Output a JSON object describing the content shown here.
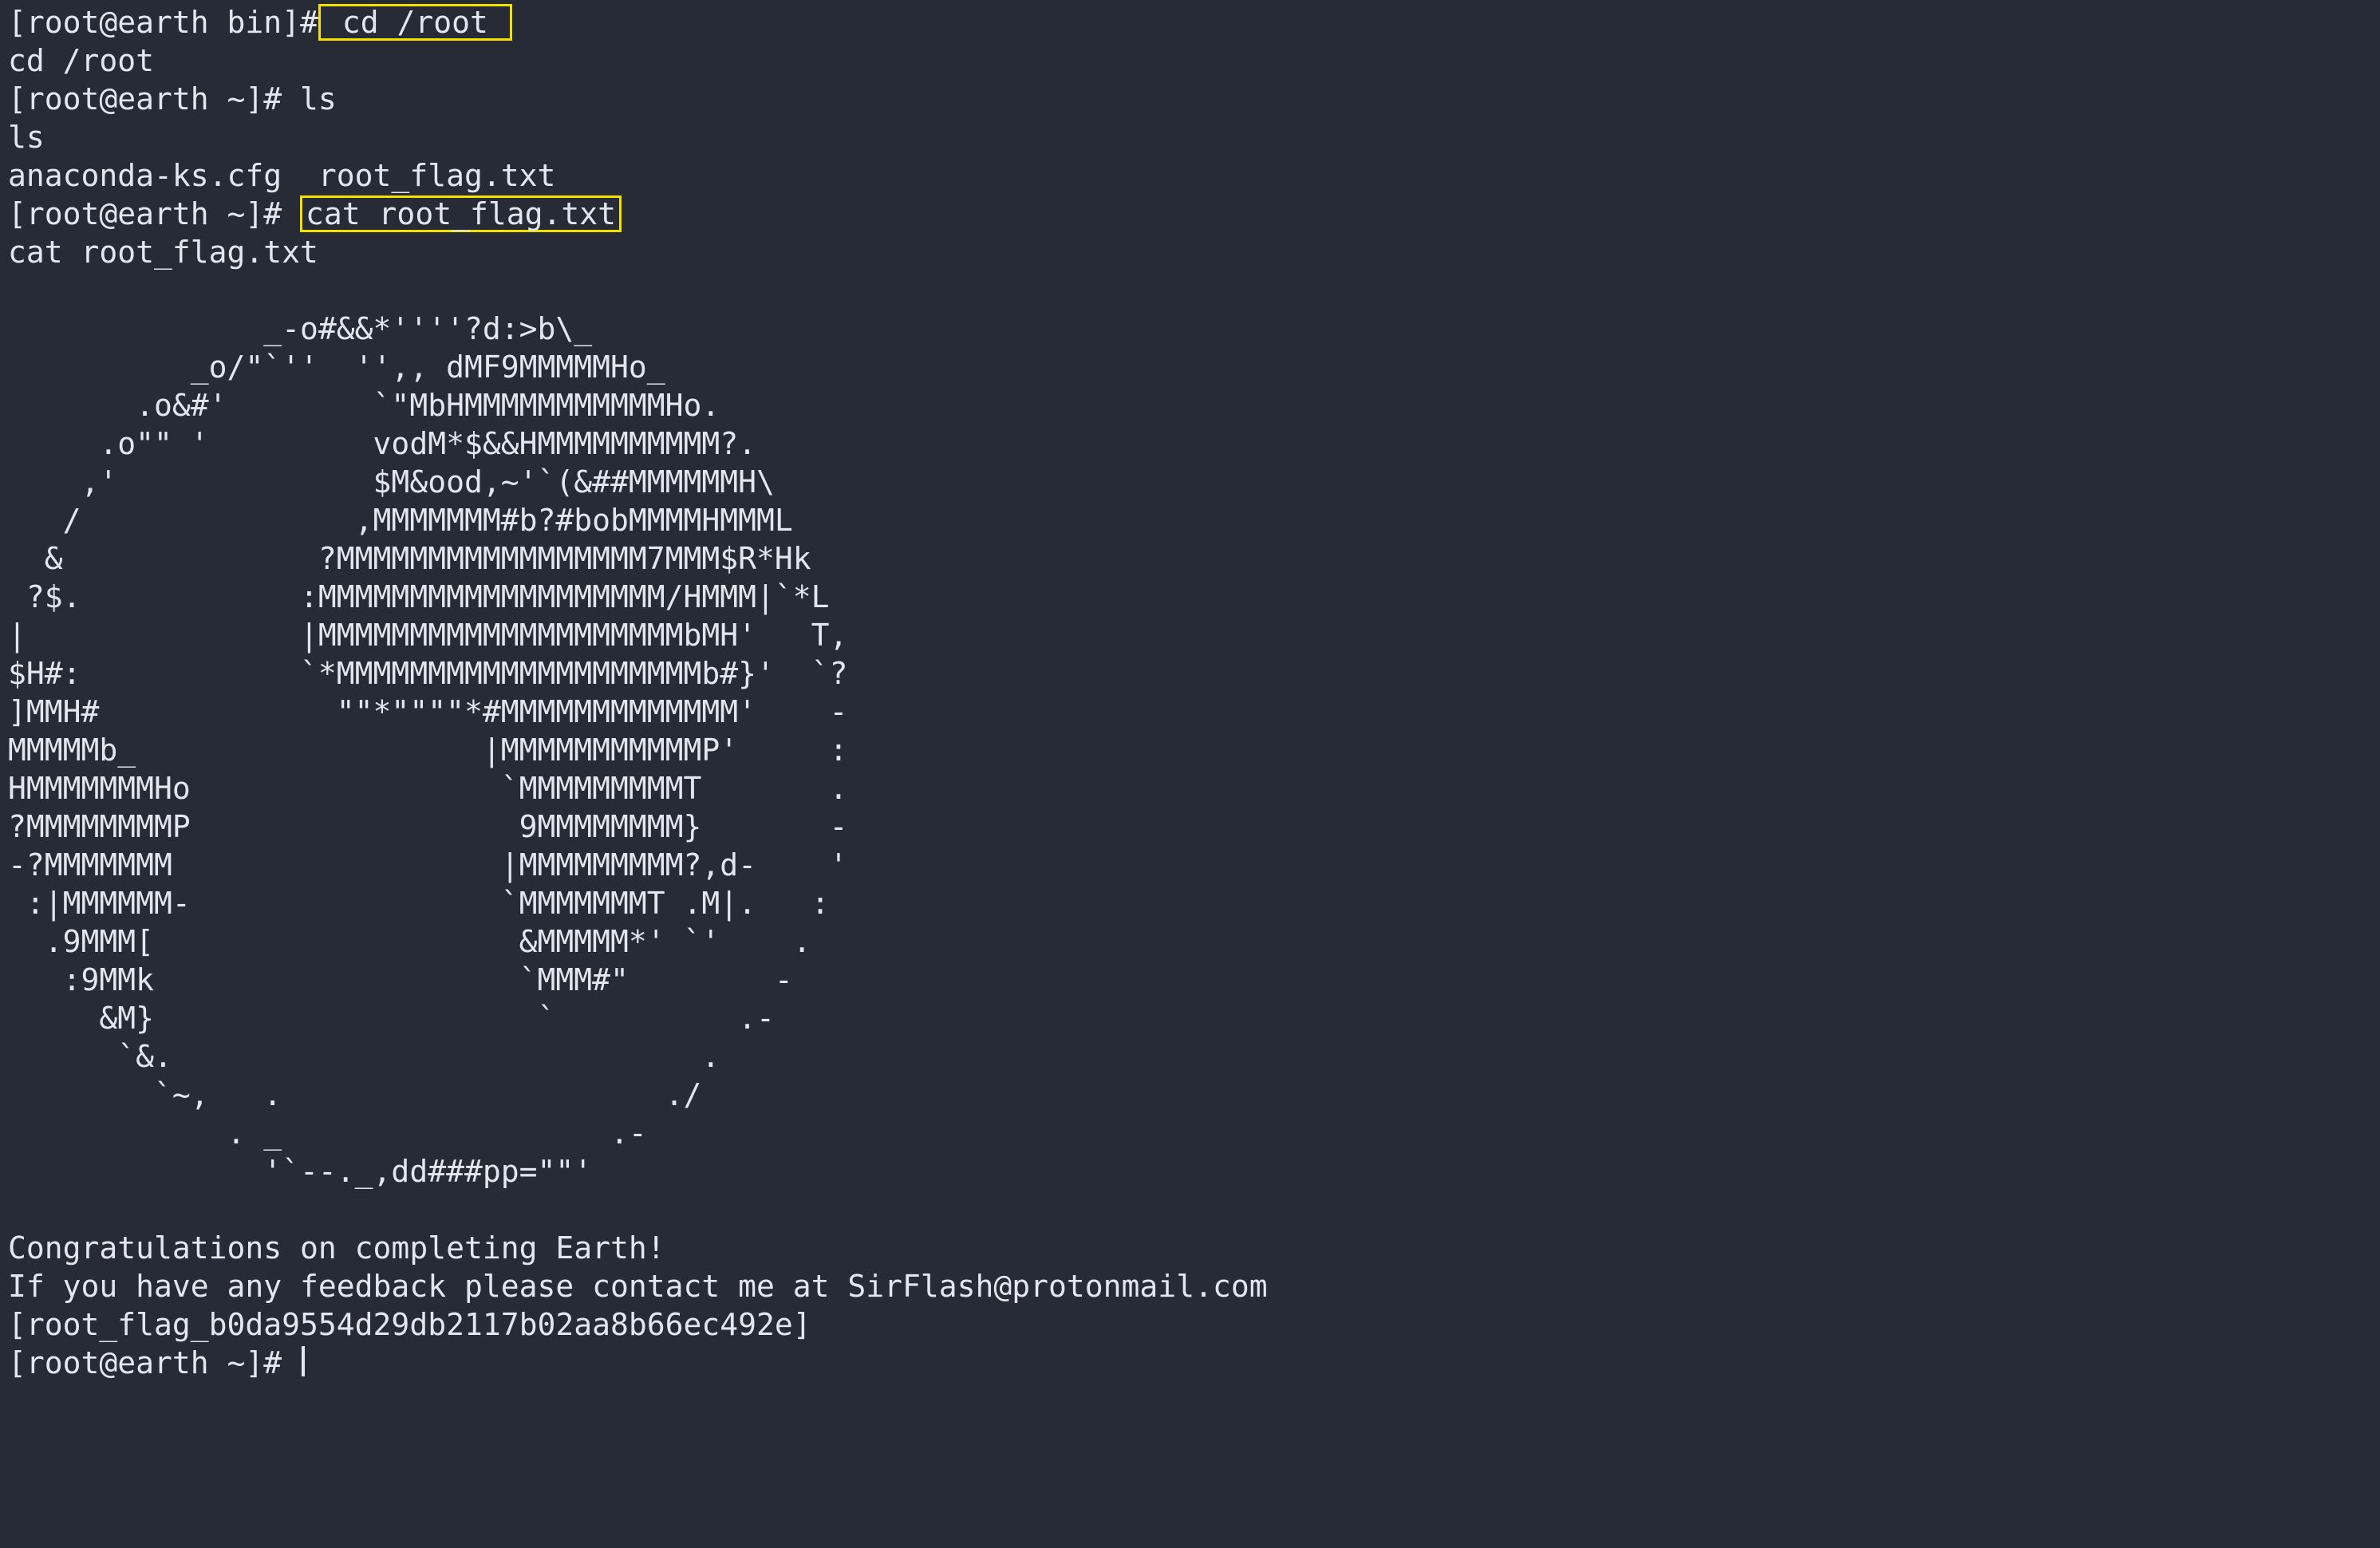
{
  "lines": {
    "l1_prompt": "[root@earth bin]#",
    "l1_cmd": " cd /root ",
    "l2": "cd /root",
    "l3": "[root@earth ~]# ls",
    "l4": "ls",
    "l5": "anaconda-ks.cfg  root_flag.txt",
    "l6_prompt": "[root@earth ~]# ",
    "l6_cmd": "cat root_flag.txt",
    "l7": "cat root_flag.txt",
    "a01": "              _-o#&&*''''?d:>b\\_",
    "a02": "          _o/\"`''  '',, dMF9MMMMMHo_",
    "a03": "       .o&#'        `\"MbHMMMMMMMMMMMHo.",
    "a04": "     .o\"\" '         vodM*$&&HMMMMMMMMMM?.",
    "a05": "    ,'              $M&ood,~'`(&##MMMMMMH\\",
    "a06": "   /               ,MMMMMMM#b?#bobMMMMHMMML",
    "a07": "  &              ?MMMMMMMMMMMMMMMMM7MMM$R*Hk",
    "a08": " ?$.            :MMMMMMMMMMMMMMMMMMM/HMMM|`*L",
    "a09": "|               |MMMMMMMMMMMMMMMMMMMMbMH'   T,",
    "a10": "$H#:            `*MMMMMMMMMMMMMMMMMMMMb#}'  `?",
    "a11": "]MMH#             \"\"*\"\"\"\"*#MMMMMMMMMMMMM'    -",
    "a12": "MMMMMb_                   |MMMMMMMMMMMP'     :",
    "a13": "HMMMMMMMHo                 `MMMMMMMMMT       .",
    "a14": "?MMMMMMMMP                  9MMMMMMMM}       -",
    "a15": "-?MMMMMMM                  |MMMMMMMMM?,d-    '",
    "a16": " :|MMMMMM-                 `MMMMMMMT .M|.   :",
    "a17": "  .9MMM[                    &MMMMM*' `'    .",
    "a18": "   :9MMk                    `MMM#\"        -",
    "a19": "     &M}                     `          .-",
    "a20": "      `&.                             .",
    "a21": "        `~,   .                     ./",
    "a22": "            . _                  .-",
    "a23": "              '`--._,dd###pp=\"\"'",
    "msg1": "Congratulations on completing Earth!",
    "msg2": "If you have any feedback please contact me at SirFlash@protonmail.com",
    "flag": "[root_flag_b0da9554d29db2117b02aa8b66ec492e]",
    "final_prompt": "[root@earth ~]# "
  }
}
